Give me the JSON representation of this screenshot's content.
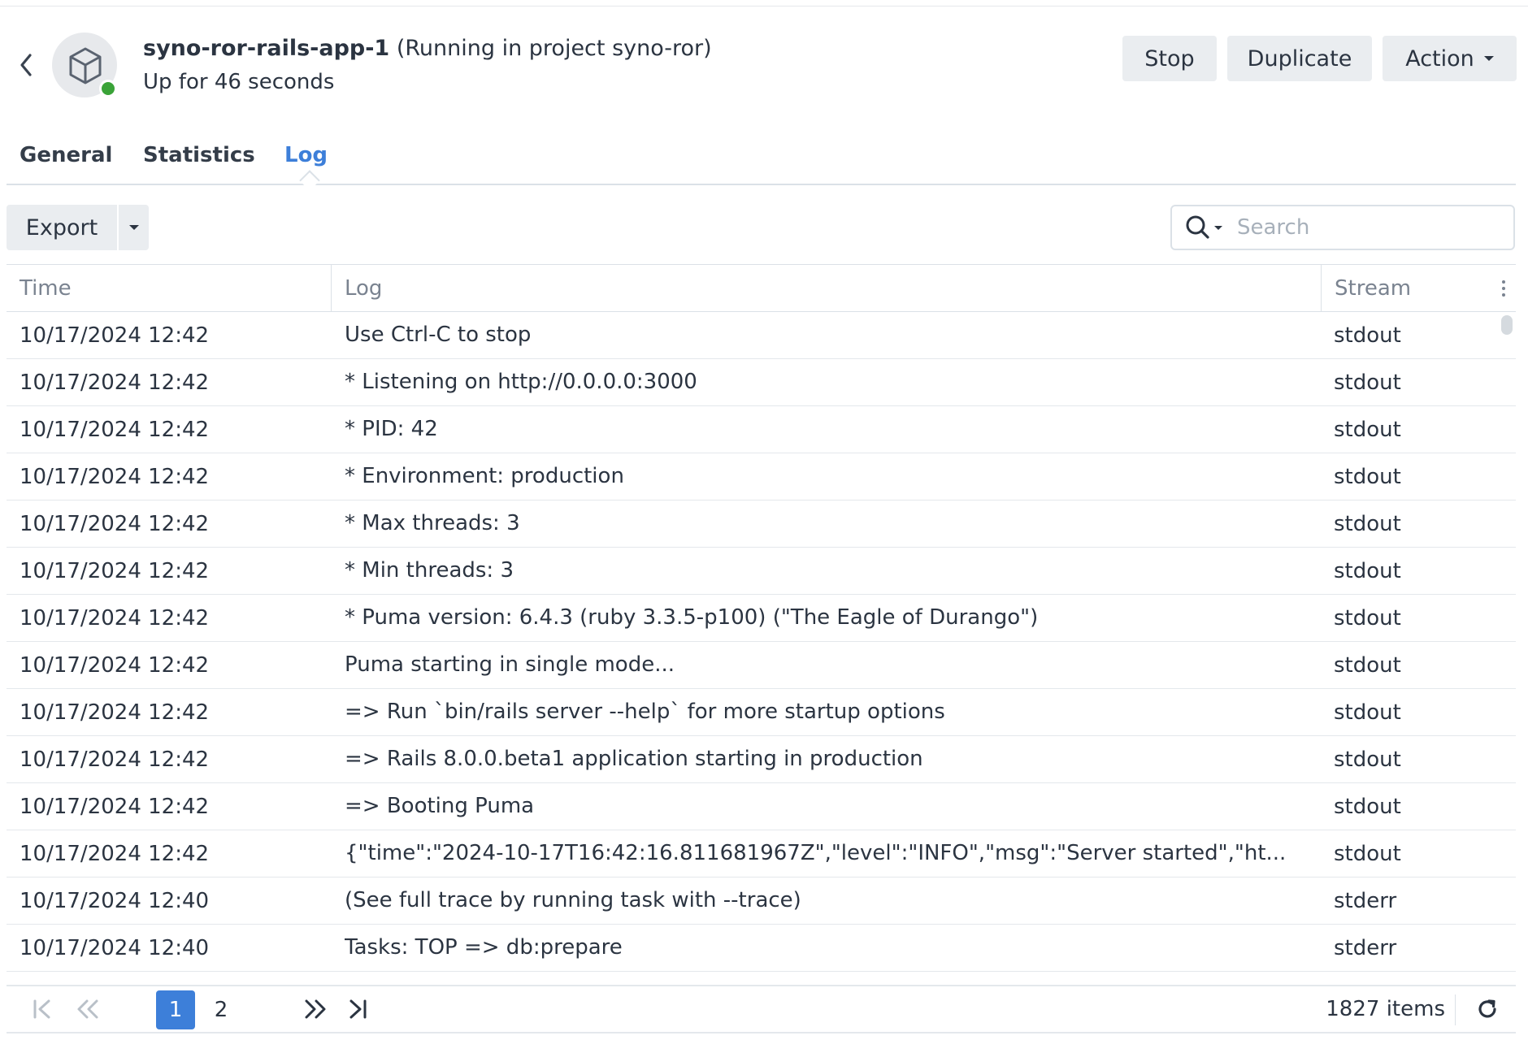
{
  "header": {
    "container_name": "syno-ror-rails-app-1",
    "project_note": "(Running in project syno-ror)",
    "uptime": "Up for 46 seconds",
    "buttons": {
      "stop": "Stop",
      "duplicate": "Duplicate",
      "action": "Action"
    },
    "status_color": "#3aa338"
  },
  "tabs": [
    {
      "label": "General",
      "active": false
    },
    {
      "label": "Statistics",
      "active": false
    },
    {
      "label": "Log",
      "active": true
    }
  ],
  "toolbar": {
    "export_label": "Export",
    "search_placeholder": "Search"
  },
  "table": {
    "columns": [
      "Time",
      "Log",
      "Stream"
    ],
    "rows": [
      {
        "time": "10/17/2024 12:42",
        "log": "Use Ctrl-C to stop",
        "stream": "stdout"
      },
      {
        "time": "10/17/2024 12:42",
        "log": "* Listening on http://0.0.0.0:3000",
        "stream": "stdout"
      },
      {
        "time": "10/17/2024 12:42",
        "log": "* PID: 42",
        "stream": "stdout"
      },
      {
        "time": "10/17/2024 12:42",
        "log": "* Environment: production",
        "stream": "stdout"
      },
      {
        "time": "10/17/2024 12:42",
        "log": "* Max threads: 3",
        "stream": "stdout"
      },
      {
        "time": "10/17/2024 12:42",
        "log": "* Min threads: 3",
        "stream": "stdout"
      },
      {
        "time": "10/17/2024 12:42",
        "log": "* Puma version: 6.4.3 (ruby 3.3.5-p100) (\"The Eagle of Durango\")",
        "stream": "stdout"
      },
      {
        "time": "10/17/2024 12:42",
        "log": "Puma starting in single mode...",
        "stream": "stdout"
      },
      {
        "time": "10/17/2024 12:42",
        "log": "=> Run `bin/rails server --help` for more startup options",
        "stream": "stdout"
      },
      {
        "time": "10/17/2024 12:42",
        "log": "=> Rails 8.0.0.beta1 application starting in production",
        "stream": "stdout"
      },
      {
        "time": "10/17/2024 12:42",
        "log": "=> Booting Puma",
        "stream": "stdout"
      },
      {
        "time": "10/17/2024 12:42",
        "log": "{\"time\":\"2024-10-17T16:42:16.811681967Z\",\"level\":\"INFO\",\"msg\":\"Server started\",\"ht...",
        "stream": "stdout"
      },
      {
        "time": "10/17/2024 12:40",
        "log": "(See full trace by running task with --trace)",
        "stream": "stderr"
      },
      {
        "time": "10/17/2024 12:40",
        "log": "Tasks: TOP => db:prepare",
        "stream": "stderr"
      }
    ]
  },
  "pagination": {
    "pages": [
      "1",
      "2"
    ],
    "current_page": "1",
    "items_text": "1827 items"
  },
  "colors": {
    "accent": "#3d7fd9",
    "button_bg": "#eaedf0"
  }
}
